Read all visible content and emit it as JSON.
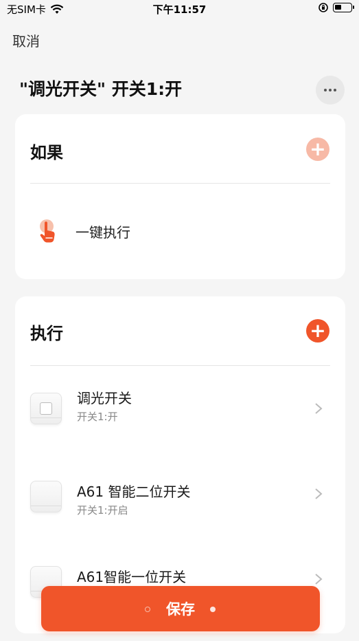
{
  "status_bar": {
    "carrier": "无SIM卡",
    "time": "下午11:57"
  },
  "nav": {
    "cancel_label": "取消",
    "title": "\"调光开关\" 开关1:开"
  },
  "if_section": {
    "title": "如果",
    "trigger_label": "一键执行",
    "plus_color": "#f7b9a6"
  },
  "exec_section": {
    "title": "执行",
    "plus_color": "#f0552a",
    "devices": [
      {
        "name": "调光开关",
        "state": "开关1:开"
      },
      {
        "name": "A61 智能二位开关",
        "state": "开关1:开启"
      },
      {
        "name": "A61智能一位开关",
        "state": ""
      }
    ]
  },
  "save_label": "保存",
  "accent_color": "#f0552a"
}
